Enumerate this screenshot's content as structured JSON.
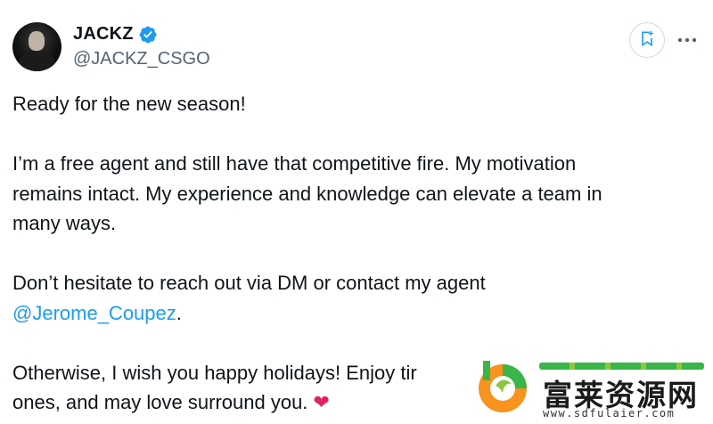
{
  "tweet": {
    "author": {
      "display_name": "JACKZ",
      "handle": "@JACKZ_CSGO",
      "verified": true
    },
    "lines": {
      "p1": "Ready for the new season!",
      "p2a": "I’m a free agent and still have that competitive fire. My motivation",
      "p2b": "remains intact. My experience and knowledge can elevate a team in",
      "p2c": "many ways.",
      "p3a": "Don’t hesitate to reach out via DM or contact my agent",
      "p3_mention": "@Jerome_Coupez",
      "p3_period": ".",
      "p4a": "Otherwise, I wish you happy holidays! Enjoy tir",
      "p4b": "ones, and may love surround you.",
      "heart": "❤"
    }
  },
  "actions": {
    "bookmark_icon": "bookmark-plus-icon",
    "more_icon": "more-icon"
  },
  "watermark": {
    "cn_text": "富莱资源网",
    "url": "www.sdfulaier.com"
  },
  "colors": {
    "text": "#0f1419",
    "secondary": "#536471",
    "link": "#1d9bf0",
    "verified": "#1d9bf0",
    "heart": "#e0245e"
  }
}
